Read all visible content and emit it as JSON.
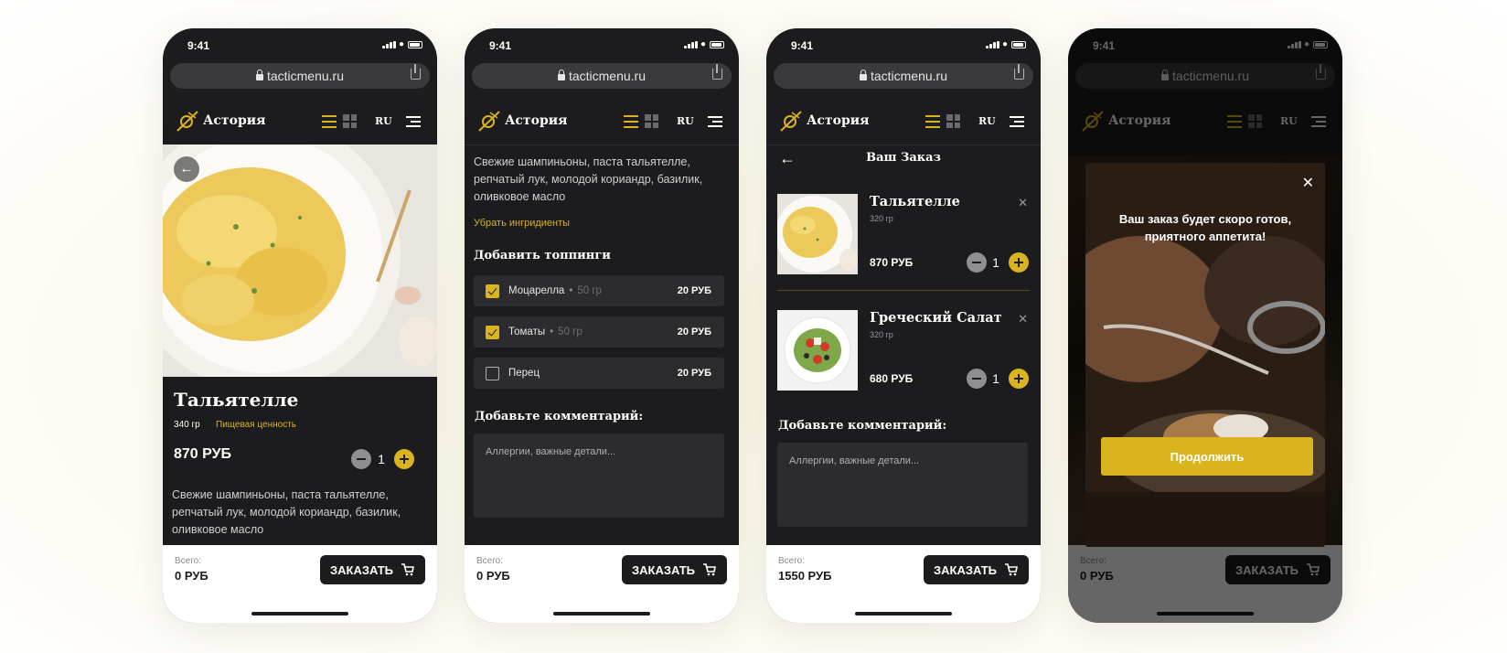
{
  "status": {
    "time": "9:41"
  },
  "browser": {
    "url": "tacticmenu.ru"
  },
  "header": {
    "brand": "Астория",
    "lang": "RU"
  },
  "dish": {
    "title": "Тальятелле",
    "weight": "340 гр",
    "nutrition_link": "Пищевая ценность",
    "price": "870 РУБ",
    "qty": "1",
    "description": "Свежие шампиньоны, паста тальятелле, репчатый лук, молодой кориандр, базилик, оливковое масло"
  },
  "customize": {
    "description": "Свежие шампиньоны, паста тальятелле, репчатый лук, молодой кориандр, базилик, оливковое масло",
    "remove_ingredients": "Убрать ингридиенты",
    "toppings_title": "Добавить топпинги",
    "toppings": [
      {
        "name": "Моцарелла",
        "dot": "•",
        "weight": "50 гр",
        "price": "20 РУБ",
        "checked": true
      },
      {
        "name": "Томаты",
        "dot": "•",
        "weight": "50 гр",
        "price": "20 РУБ",
        "checked": true
      },
      {
        "name": "Перец",
        "dot": "",
        "weight": "",
        "price": "20 РУБ",
        "checked": false
      }
    ],
    "comment_title": "Добавьте комментарий:",
    "comment_placeholder": "Аллергии, важные детали..."
  },
  "order": {
    "title": "Ваш Заказ",
    "items": [
      {
        "name": "Тальятелле",
        "weight": "320 гр",
        "price": "870 РУБ",
        "qty": "1"
      },
      {
        "name": "Греческий Салат",
        "weight": "320 гр",
        "price": "680 РУБ",
        "qty": "1"
      }
    ],
    "comment_title": "Добавьте комментарий:",
    "comment_placeholder": "Аллергии, важные детали..."
  },
  "modal": {
    "message": "Ваш заказ будет скоро готов, приятного аппетита!",
    "button": "Продолжить"
  },
  "footer": {
    "total_label": "Всего:",
    "total_empty": "0 РУБ",
    "total_order": "1550 РУБ",
    "order_button": "ЗАКАЗАТЬ"
  },
  "colors": {
    "accent": "#d9b41e",
    "dark": "#1c1c1e"
  }
}
